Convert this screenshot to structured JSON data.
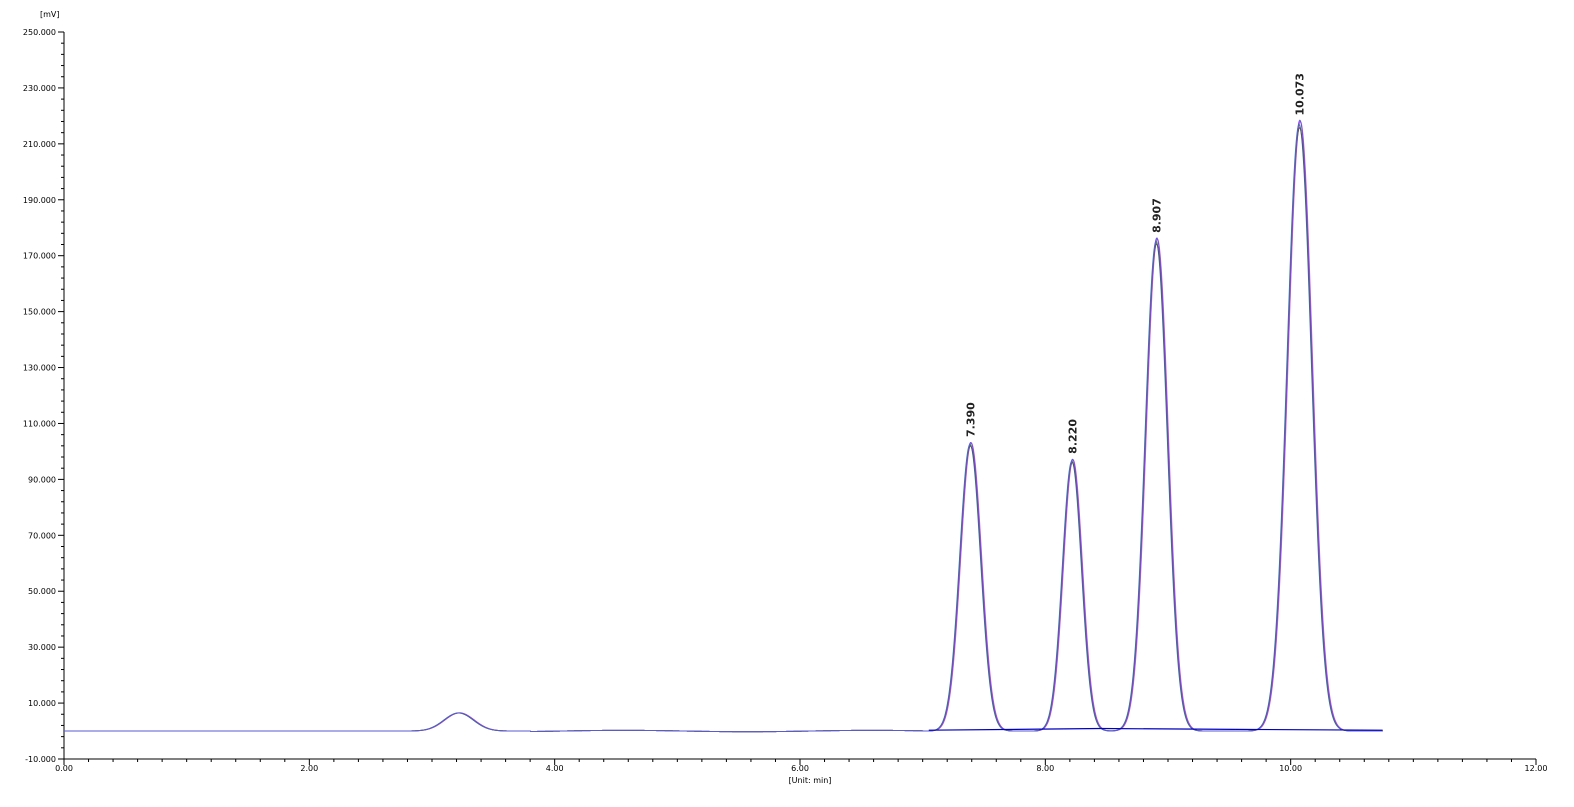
{
  "chart_data": {
    "type": "line",
    "title": "",
    "xlabel": "[Unit: min]",
    "ylabel": "[mV]",
    "xlim": [
      0,
      12
    ],
    "ylim": [
      -10,
      250
    ],
    "x_ticks": [
      "0.00",
      "2.00",
      "4.00",
      "6.00",
      "8.00",
      "10.00",
      "12.00"
    ],
    "x_tick_values": [
      0,
      2,
      4,
      6,
      8,
      10,
      12
    ],
    "y_ticks": [
      "-10.000",
      "10.000",
      "30.000",
      "50.000",
      "70.000",
      "90.000",
      "110.000",
      "130.000",
      "150.000",
      "170.000",
      "190.000",
      "210.000",
      "230.000",
      "250.000"
    ],
    "y_tick_values": [
      -10,
      10,
      30,
      50,
      70,
      90,
      110,
      130,
      150,
      170,
      190,
      210,
      230,
      250
    ],
    "grid": false,
    "legend": "none",
    "x_end": 10.75,
    "peaks": [
      {
        "label": "",
        "rt": 3.22,
        "height": 6.5,
        "sigma": 0.12
      },
      {
        "label": "7.390",
        "rt": 7.39,
        "height": 103,
        "sigma": 0.085
      },
      {
        "label": "8.220",
        "rt": 8.22,
        "height": 97,
        "sigma": 0.078
      },
      {
        "label": "8.907",
        "rt": 8.907,
        "height": 176,
        "sigma": 0.09
      },
      {
        "label": "10.073",
        "rt": 10.073,
        "height": 218,
        "sigma": 0.1
      }
    ],
    "baseline_segments": [
      [
        7.05,
        0.3,
        8.45,
        0.9
      ],
      [
        8.45,
        0.9,
        9.55,
        0.6
      ],
      [
        9.55,
        0.6,
        10.75,
        0.3
      ]
    ],
    "series": [
      {
        "color": "#ff40ff"
      },
      {
        "color": "#2d8b57"
      },
      {
        "color": "#555555"
      },
      {
        "color": "#5a5ad6"
      }
    ],
    "baseline_color": "#0000c0"
  }
}
